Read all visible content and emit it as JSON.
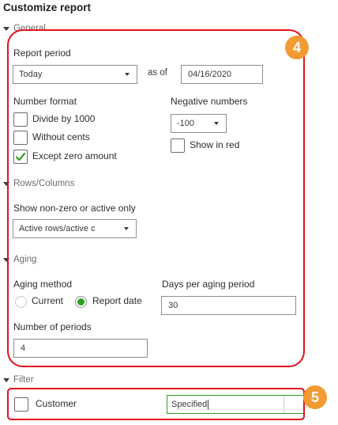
{
  "title": "Customize report",
  "general": {
    "section_label": "General",
    "report_period_label": "Report period",
    "report_period_value": "Today",
    "as_of_label": "as of",
    "as_of_date": "04/16/2020",
    "number_format_label": "Number format",
    "divide_label": "Divide by 1000",
    "without_cents_label": "Without cents",
    "except_zero_label": "Except zero amount",
    "negative_numbers_label": "Negative numbers",
    "negative_value": "-100",
    "show_in_red_label": "Show in red"
  },
  "rows_columns": {
    "section_label": "Rows/Columns",
    "show_label": "Show non-zero or active only",
    "show_value": "Active rows/active c "
  },
  "aging": {
    "section_label": "Aging",
    "method_label": "Aging method",
    "current_label": "Current",
    "report_date_label": "Report date",
    "days_label": "Days per aging period",
    "days_value": "30",
    "num_periods_label": "Number of periods",
    "num_periods_value": "4"
  },
  "filter": {
    "section_label": "Filter",
    "customer_label": "Customer",
    "customer_value": "Specified"
  },
  "annotations": {
    "badge4": "4",
    "badge5": "5"
  },
  "colors": {
    "annotation_red": "#e4111c",
    "badge_orange": "#f29b33",
    "accent_green": "#2ca01c"
  }
}
